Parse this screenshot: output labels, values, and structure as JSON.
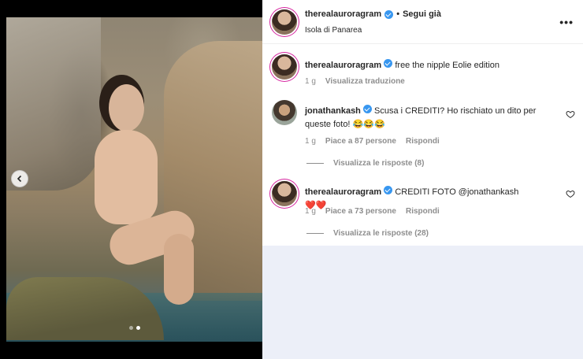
{
  "post": {
    "username": "therealauroragram",
    "separator": "•",
    "follow_label": "Segui già",
    "location": "Isola di Panarea",
    "more_label": "•••"
  },
  "comments": [
    {
      "username": "therealauroragram",
      "text": "free the nipple Eolie edition",
      "time": "1 g",
      "action": "Visualizza traduzione"
    },
    {
      "username": "jonathankash",
      "text": "Scusa i CREDITI? Ho rischiato un dito per queste foto!",
      "emoji": "😂😂😂",
      "time": "1 g",
      "likes": "Piace a 87 persone",
      "reply_label": "Rispondi",
      "view_replies": "Visualizza le risposte (8)"
    },
    {
      "username": "therealauroragram",
      "text": "CREDITI FOTO @jonathankash",
      "emoji": "❤️❤️",
      "time": "1 g",
      "likes": "Piace a 73 persone",
      "reply_label": "Rispondi",
      "view_replies": "Visualizza le risposte (28)"
    }
  ],
  "media": {
    "carousel_total": 2,
    "carousel_active": 2
  },
  "colors": {
    "verified": "#3897f0",
    "heart_emoji": "#e0245e",
    "panel_bg": "#eceff8"
  }
}
